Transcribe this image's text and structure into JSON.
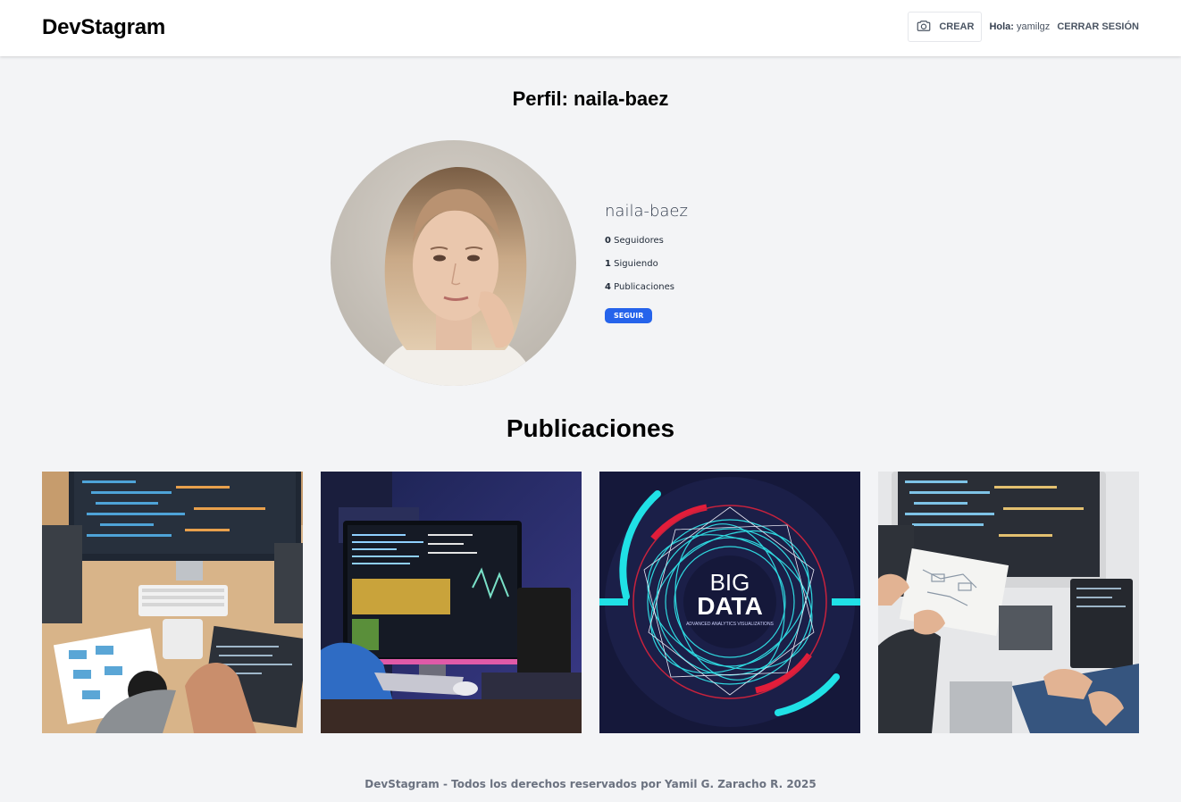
{
  "header": {
    "logo": "DevStagram",
    "create_label": "CREAR",
    "greeting_label": "Hola:",
    "greeting_user": "yamilgz",
    "logout_label": "CERRAR SESIÓN"
  },
  "profile": {
    "title": "Perfil: naila-baez",
    "username": "naila-baez",
    "followers_count": "0",
    "followers_label": "Seguidores",
    "following_count": "1",
    "following_label": "Siguiendo",
    "posts_count": "4",
    "posts_label": "Publicaciones",
    "follow_label": "SEGUIR"
  },
  "posts": {
    "title": "Publicaciones",
    "items": [
      {
        "image": "developer-desk-overhead"
      },
      {
        "image": "developer-monitor-dark-room"
      },
      {
        "image": "big-data-poster",
        "text_big": "BIG",
        "text_data": "DATA",
        "text_sub": "ADVANCED ANALYTICS VISUALIZATIONS"
      },
      {
        "image": "developers-laptops-team"
      }
    ]
  },
  "footer": {
    "text": "DevStagram - Todos los derechos reservados por Yamil G. Zaracho R. 2025"
  },
  "colors": {
    "accent": "#2563eb",
    "background": "#f3f4f6",
    "header_bg": "#ffffff"
  }
}
